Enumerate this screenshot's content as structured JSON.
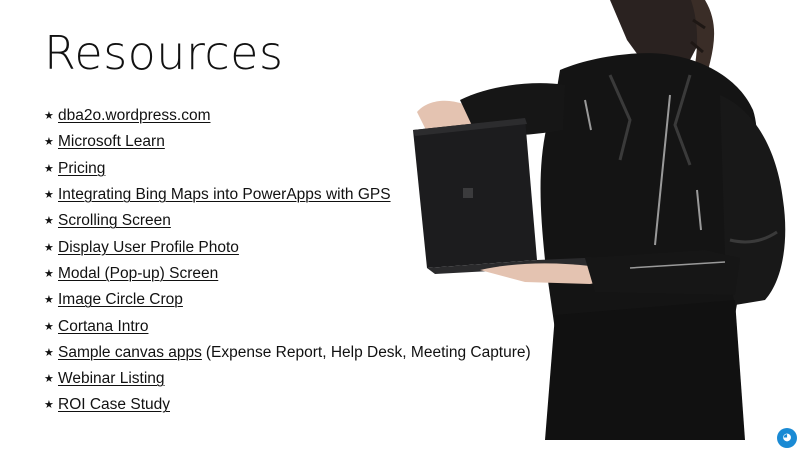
{
  "slide": {
    "title": "Resources",
    "items": [
      {
        "label": "dba2o.wordpress.com",
        "suffix": ""
      },
      {
        "label": "Microsoft Learn",
        "suffix": ""
      },
      {
        "label": "Pricing",
        "suffix": ""
      },
      {
        "label": "Integrating Bing Maps into PowerApps with GPS",
        "suffix": ""
      },
      {
        "label": "Scrolling Screen",
        "suffix": ""
      },
      {
        "label": "Display User Profile Photo",
        "suffix": ""
      },
      {
        "label": "Modal (Pop-up) Screen",
        "suffix": ""
      },
      {
        "label": "Image Circle Crop",
        "suffix": ""
      },
      {
        "label": "Cortana Intro",
        "suffix": ""
      },
      {
        "label": "Sample canvas apps",
        "suffix": "(Expense Report, Help Desk, Meeting Capture)"
      },
      {
        "label": "Webinar Listing",
        "suffix": ""
      },
      {
        "label": "ROI Case Study",
        "suffix": ""
      }
    ],
    "bullet_glyph": "★",
    "badge_icon": "logo-badge-icon",
    "colors": {
      "text": "#111111",
      "background": "#ffffff",
      "badge": "#1a8ad4",
      "jacket": "#141414",
      "laptop": "#1c1c1e"
    }
  }
}
